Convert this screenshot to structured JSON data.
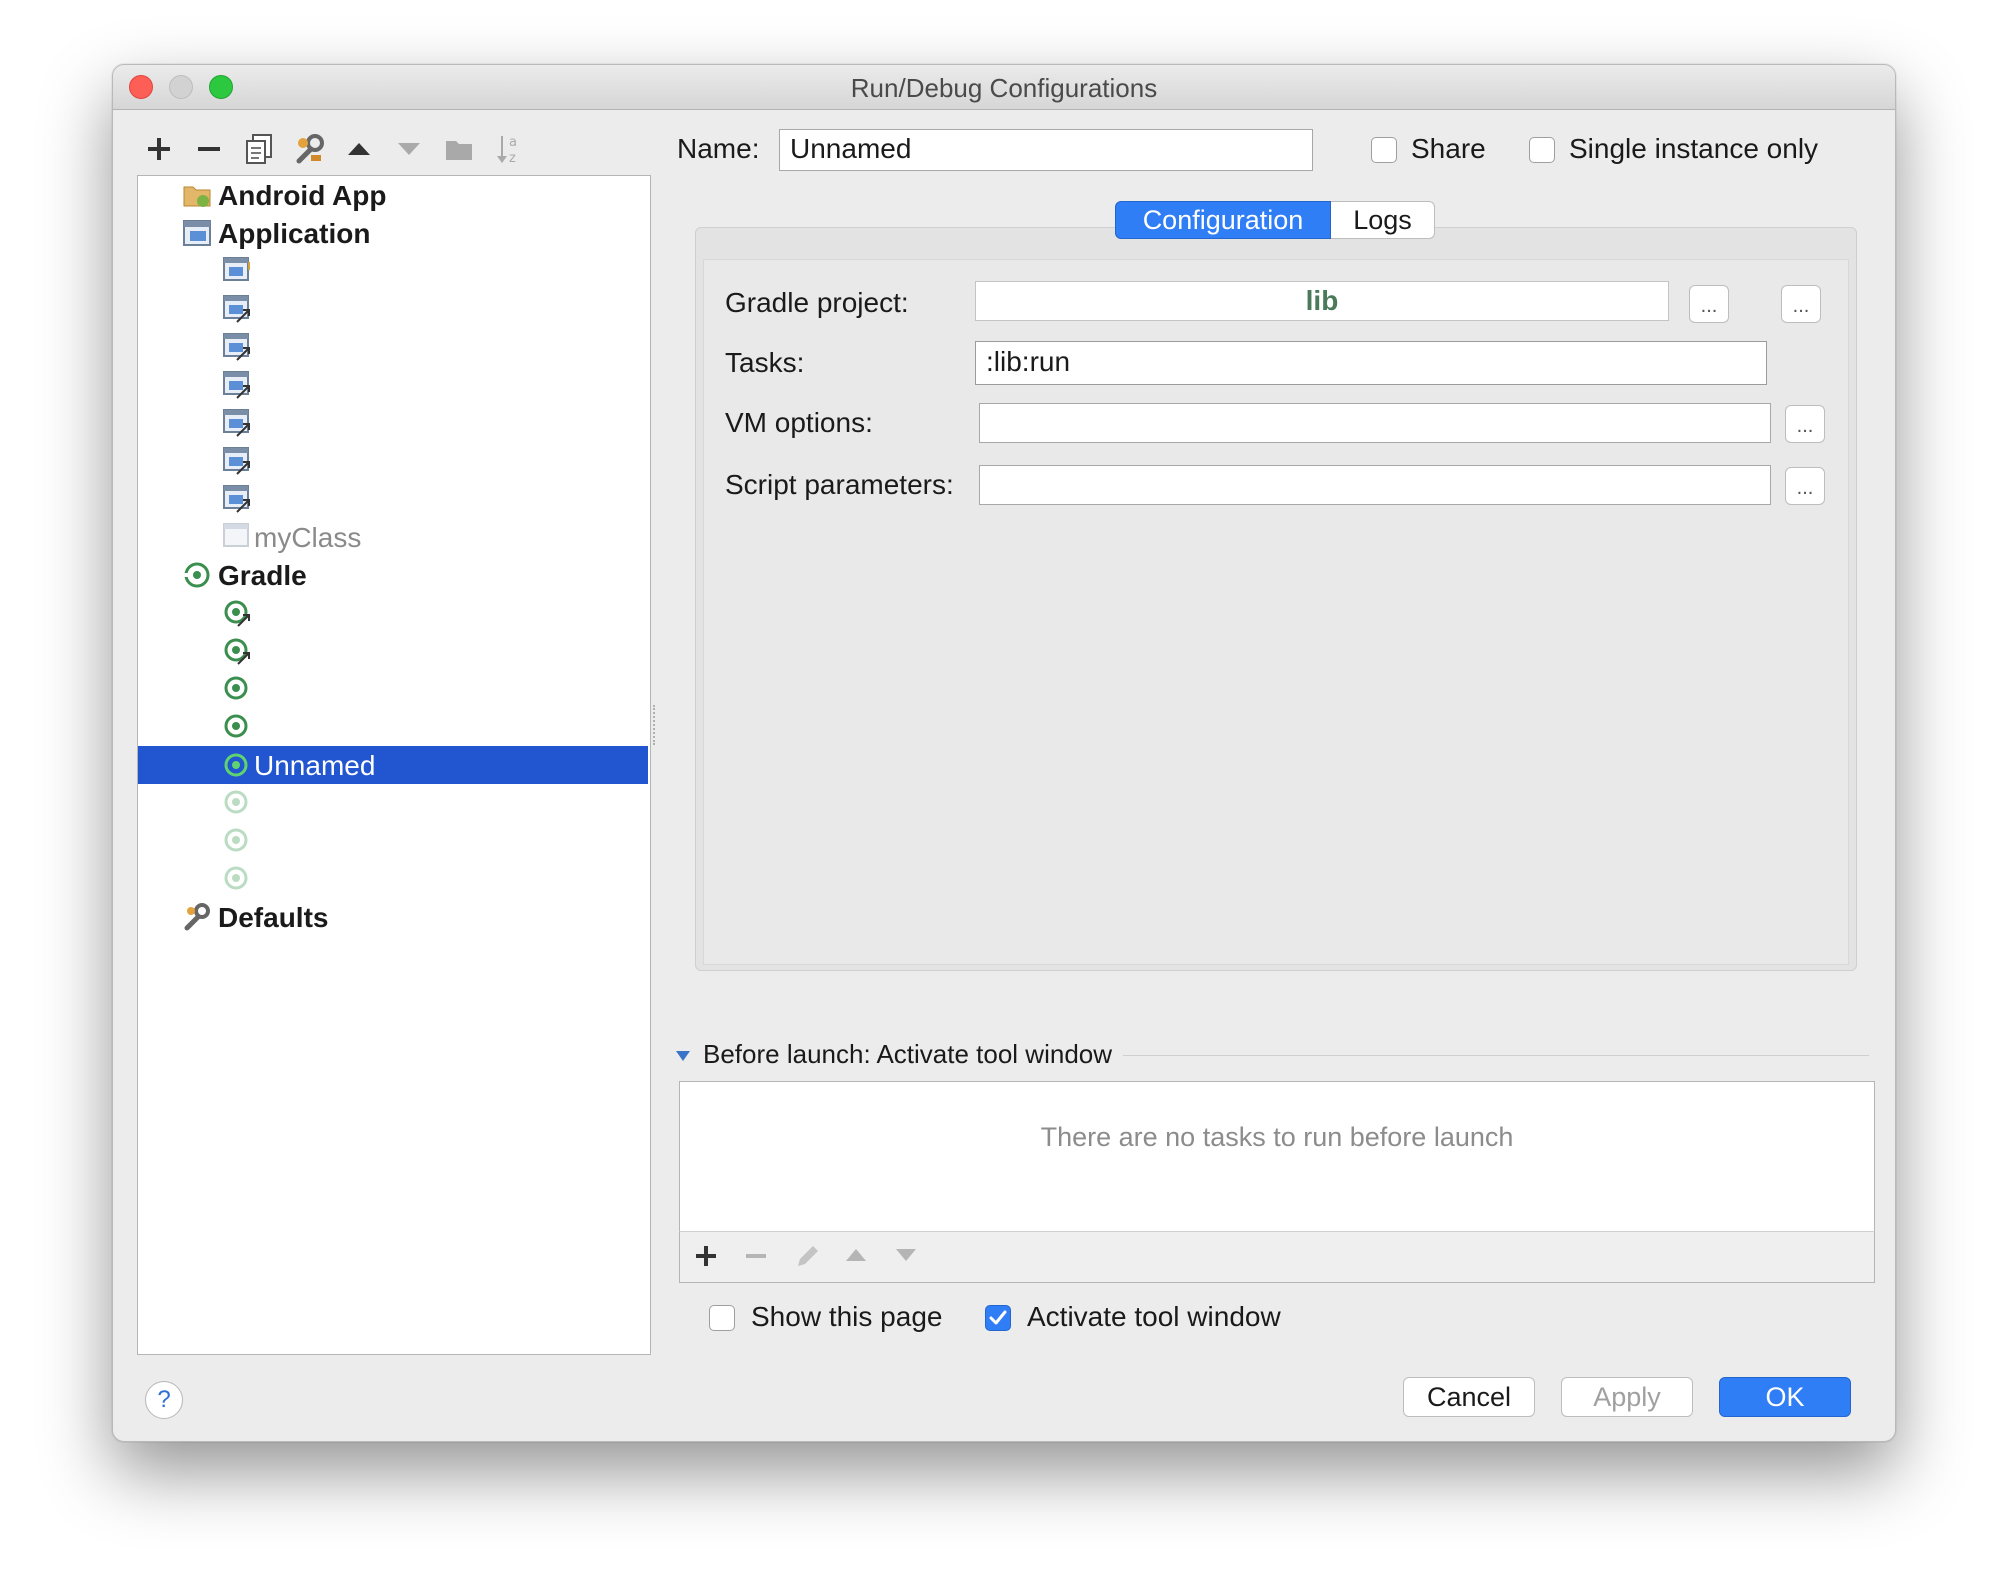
{
  "window": {
    "title": "Run/Debug Configurations"
  },
  "toolbar": {
    "icons": [
      "plus-icon",
      "minus-icon",
      "copy-icon",
      "wrench-icon",
      "arrow-up-icon",
      "arrow-down-icon",
      "folder-icon",
      "sort-az-icon"
    ]
  },
  "tree": {
    "groups": {
      "android": "Android App",
      "application": "Application",
      "gradle": "Gradle",
      "defaults": "Defaults"
    },
    "app_items": {
      "myclass": "myClass"
    },
    "gradle_items": {
      "selected": "Unnamed"
    }
  },
  "form": {
    "name_label": "Name:",
    "name_value": "Unnamed",
    "share_label": "Share",
    "single_instance_label": "Single instance only",
    "tabs": {
      "configuration": "Configuration",
      "logs": "Logs"
    },
    "gradle_project_label": "Gradle project:",
    "gradle_project_value": "lib",
    "tasks_label": "Tasks:",
    "tasks_value": ":lib:run",
    "vm_options_label": "VM options:",
    "vm_options_value": "",
    "script_params_label": "Script parameters:",
    "script_params_value": "",
    "ellipsis": "..."
  },
  "before_launch": {
    "header": "Before launch: Activate tool window",
    "empty_text": "There are no tasks to run before launch",
    "show_page_label": "Show this page",
    "activate_label": "Activate tool window",
    "show_page_checked": false,
    "activate_checked": true
  },
  "buttons": {
    "help": "?",
    "cancel": "Cancel",
    "apply": "Apply",
    "ok": "OK"
  },
  "colors": {
    "accent": "#2f7ef5",
    "selection": "#2156d0",
    "gradle_green": "#3a8e4e"
  }
}
